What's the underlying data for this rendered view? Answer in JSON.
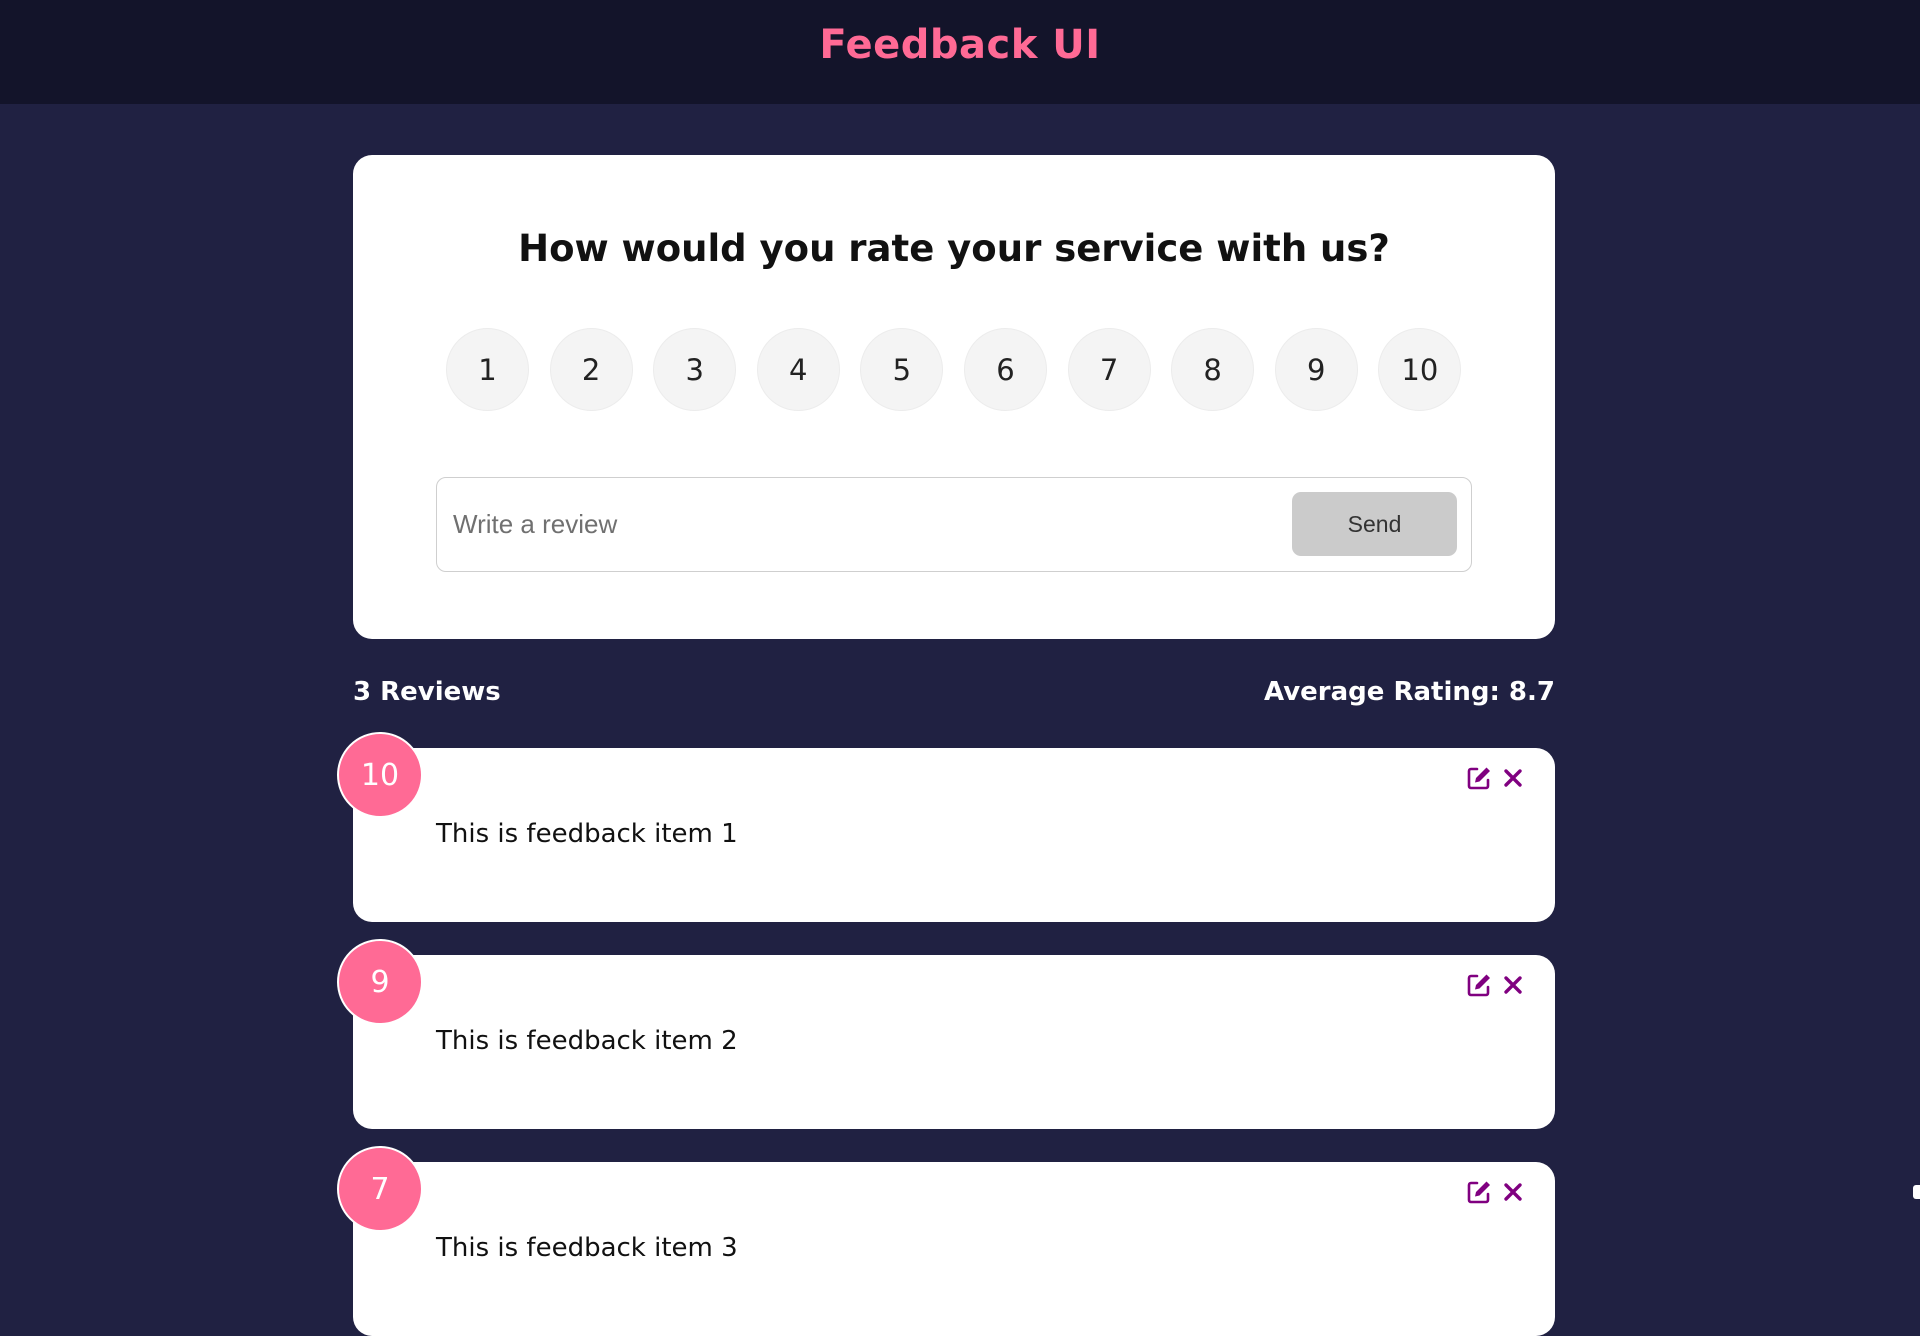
{
  "header": {
    "title": "Feedback UI",
    "title_color": "#ff6a95",
    "background": "#13142a"
  },
  "page": {
    "background": "#202142"
  },
  "form": {
    "heading": "How would you rate your service with us?",
    "ratings": [
      "1",
      "2",
      "3",
      "4",
      "5",
      "6",
      "7",
      "8",
      "9",
      "10"
    ],
    "review_placeholder": "Write a review",
    "review_value": "",
    "send_label": "Send"
  },
  "stats": {
    "count_label": "3 Reviews",
    "average_label": "Average Rating: 8.7"
  },
  "feedback": {
    "items": [
      {
        "rating": "10",
        "text": "This is feedback item 1",
        "edit_icon": "edit-icon",
        "delete_icon": "close-icon"
      },
      {
        "rating": "9",
        "text": "This is feedback item 2",
        "edit_icon": "edit-icon",
        "delete_icon": "close-icon"
      },
      {
        "rating": "7",
        "text": "This is feedback item 3",
        "edit_icon": "edit-icon",
        "delete_icon": "close-icon"
      }
    ],
    "badge_color": "#ff6a95",
    "icon_color": "#800080"
  }
}
